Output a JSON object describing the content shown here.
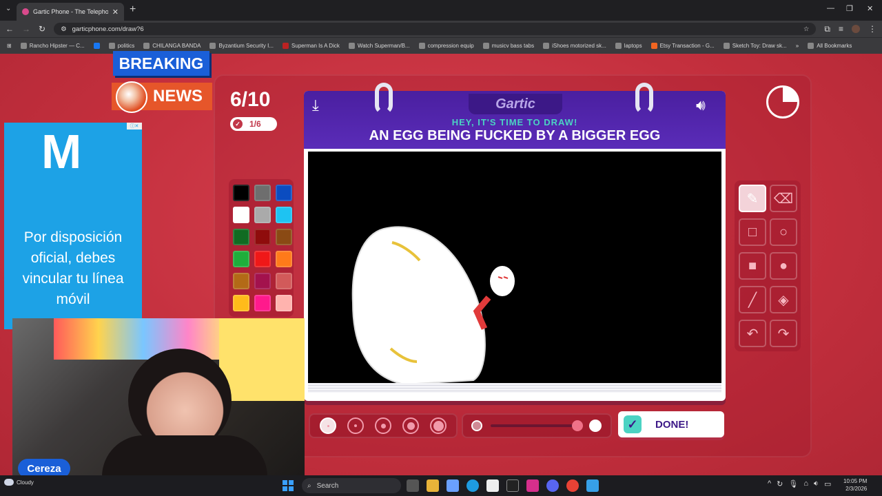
{
  "browser": {
    "tab_title": "Gartic Phone - The Telephone G",
    "url": "garticphone.com/draw?6",
    "bookmarks": [
      "Rancho Hipster — C...",
      "politics",
      "CHILANGA BANDA",
      "Byzantium Security I...",
      "Superman Is A Dick",
      "Watch Superman/B...",
      "compression equip",
      "musicv bass tabs",
      "iShoes motorized sk...",
      "laptops",
      "Etsy Transaction - G...",
      "Sketch Toy: Draw sk..."
    ],
    "all_bookmarks": "All Bookmarks"
  },
  "overlay": {
    "breaking": "BREAKING",
    "news": "NEWS",
    "cam_name": "Cereza"
  },
  "ad": {
    "logo": "M",
    "text": "Por disposición oficial, debes vincular tu línea móvil"
  },
  "game": {
    "round": "6/10",
    "sub_count": "1/6",
    "logo": "Gartic",
    "hint": "HEY, IT'S TIME TO DRAW!",
    "prompt": "AN EGG BEING FUCKED BY A BIGGER EGG",
    "done_label": "DONE!",
    "timer_fraction_elapsed": 0.25,
    "palette": [
      "#000000",
      "#6e6e6e",
      "#0b4cc0",
      "#ffffff",
      "#aaaaaa",
      "#1ec3f2",
      "#116b22",
      "#8f0c0c",
      "#8a4a14",
      "#1fae3b",
      "#ef1818",
      "#ff7a1a",
      "#b36a17",
      "#a3124d",
      "#d25a5a",
      "#ffbb1a",
      "#ff1a8c",
      "#ffb3ae"
    ],
    "tools": [
      "pencil-icon",
      "eraser-icon",
      "rect-outline-icon",
      "circle-outline-icon",
      "rect-fill-icon",
      "circle-fill-icon",
      "line-icon",
      "bucket-icon",
      "undo-icon",
      "redo-icon"
    ],
    "active_tool": "pencil-icon",
    "brush_sizes": [
      1,
      2,
      3,
      4,
      5
    ],
    "active_brush_size": 1,
    "opacity_fraction": 0.9
  },
  "taskbar": {
    "weather": "Cloudy",
    "search": "Search",
    "time": "10:05 PM",
    "date": "2/3/2026"
  }
}
